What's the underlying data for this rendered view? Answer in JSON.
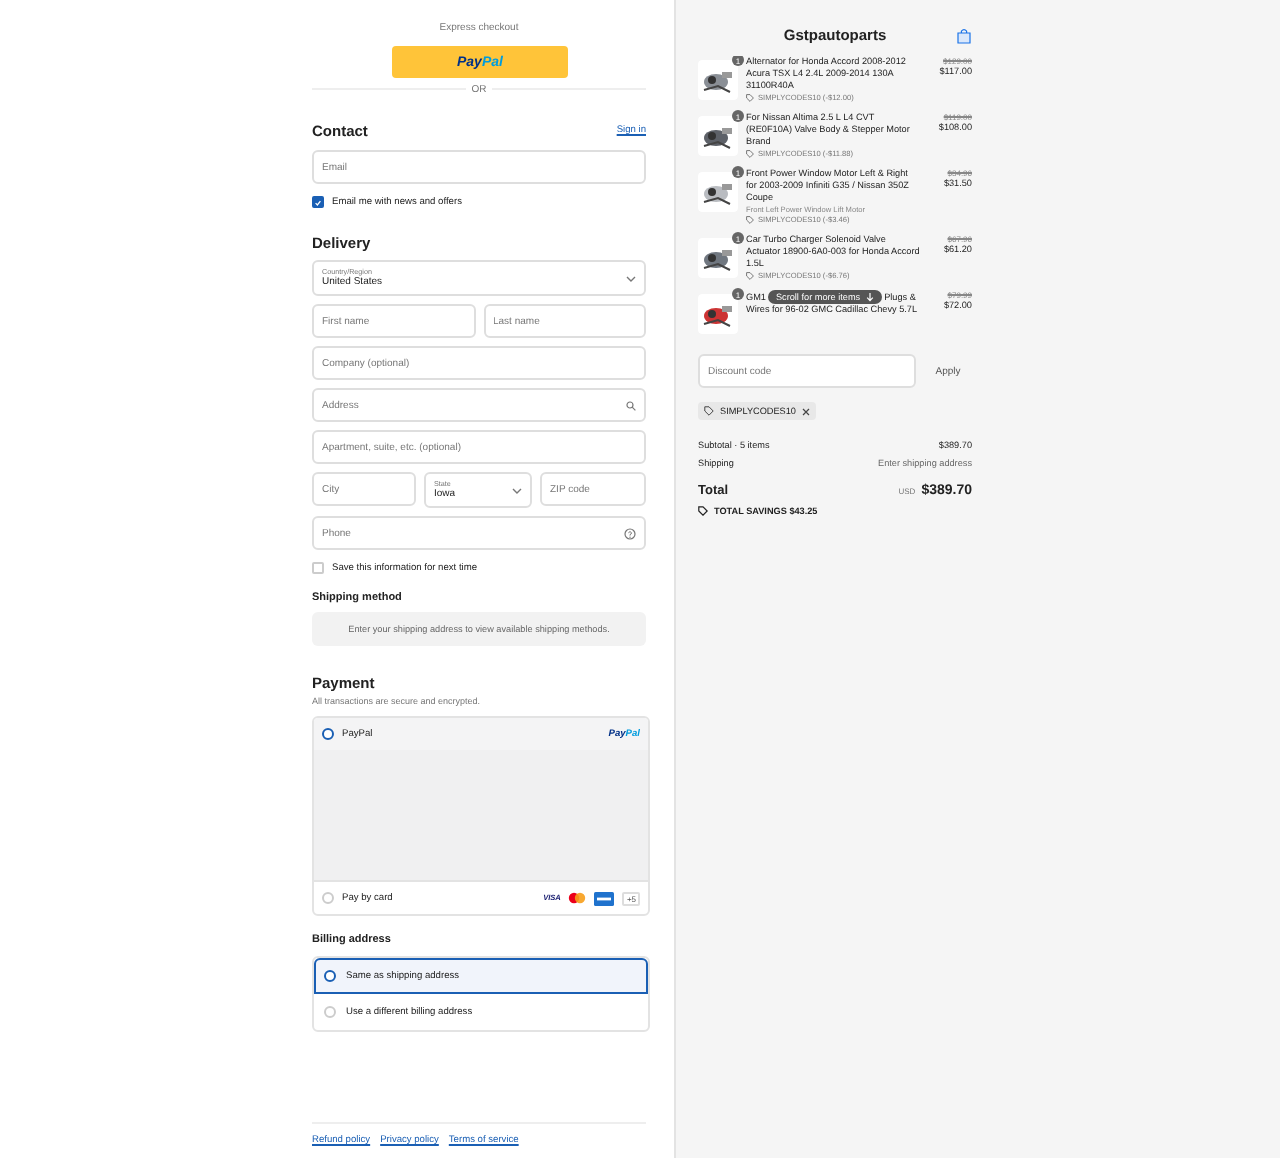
{
  "express_checkout": {
    "label": "Express checkout",
    "paypal_button": {
      "label_parts": [
        "Pay",
        "Pal"
      ]
    }
  },
  "divider_label": "OR",
  "contact": {
    "heading": "Contact",
    "sign_in": "Sign in",
    "email": {
      "placeholder": "Email"
    },
    "newsletter": {
      "label": "Email me with news and offers",
      "checked": true
    }
  },
  "delivery": {
    "heading": "Delivery",
    "country": {
      "label": "Country/Region",
      "value": "United States"
    },
    "first_name": {
      "placeholder": "First name"
    },
    "last_name": {
      "placeholder": "Last name"
    },
    "company": {
      "placeholder": "Company (optional)"
    },
    "address": {
      "placeholder": "Address"
    },
    "apartment": {
      "placeholder": "Apartment, suite, etc. (optional)"
    },
    "city": {
      "placeholder": "City"
    },
    "state": {
      "label": "State",
      "value": "Iowa"
    },
    "zip": {
      "placeholder": "ZIP code"
    },
    "phone": {
      "placeholder": "Phone"
    },
    "save_info": {
      "label": "Save this information for next time",
      "checked": false
    }
  },
  "shipping_method": {
    "heading": "Shipping method",
    "message": "Enter your shipping address to view available shipping methods."
  },
  "payment": {
    "heading": "Payment",
    "subtitle": "All transactions are secure and encrypted.",
    "options": [
      {
        "kind": "paypal",
        "label": "PayPal",
        "selected": true,
        "logo_parts": [
          "Pay",
          "Pal"
        ]
      },
      {
        "kind": "card",
        "label": "Pay by card",
        "selected": false,
        "visa_label": "VISA",
        "more_cards": "+5"
      }
    ]
  },
  "billing": {
    "heading": "Billing address",
    "options": [
      {
        "label": "Same as shipping address",
        "selected": true
      },
      {
        "label": "Use a different billing address",
        "selected": false
      }
    ]
  },
  "footer_links": [
    "Refund policy",
    "Privacy policy",
    "Terms of service"
  ],
  "summary": {
    "store_name": "Gstpautoparts",
    "items": [
      {
        "quantity": "1",
        "title": "Alternator for Honda Accord 2008-2012 Acura TSX L4 2.4L 2009-2014 130A 31100R40A",
        "discount": "SIMPLYCODES10 (-$12.00)",
        "original_price": "$129.00",
        "price": "$117.00"
      },
      {
        "quantity": "1",
        "title": "For Nissan Altima 2.5 L L4 CVT (RE0F10A) Valve Body & Stepper Motor Brand",
        "discount": "SIMPLYCODES10 (-$11.88)",
        "original_price": "$119.00",
        "price": "$108.00"
      },
      {
        "quantity": "1",
        "title": "Front Power Window Motor Left & Right for 2003-2009 Infiniti G35 / Nissan 350Z Coupe",
        "variant": "Front Left Power Window Lift Motor",
        "discount": "SIMPLYCODES10 (-$3.46)",
        "original_price": "$34.96",
        "price": "$31.50"
      },
      {
        "quantity": "1",
        "title": "Car Turbo Charger Solenoid Valve Actuator 18900-6A0-003 for Honda Accord 1.5L",
        "discount": "SIMPLYCODES10 (-$6.76)",
        "original_price": "$67.96",
        "price": "$61.20"
      },
      {
        "quantity": "1",
        "title_parts": [
          "GM1",
          "Plugs &",
          "Wires for 96-02 GMC Cadillac Chevy 5.7L"
        ],
        "original_price": "$79.99",
        "price": "$72.00"
      }
    ],
    "scroll_hint": "Scroll for more items",
    "discount_field": {
      "placeholder": "Discount code"
    },
    "apply_button": "Apply",
    "applied_code": "SIMPLYCODES10",
    "subtotal_label": "Subtotal · 5 items",
    "subtotal": "$389.70",
    "shipping_label": "Shipping",
    "shipping_value": "Enter shipping address",
    "total_label": "Total",
    "currency": "USD",
    "total": "$389.70",
    "savings": "TOTAL SAVINGS $43.25"
  }
}
